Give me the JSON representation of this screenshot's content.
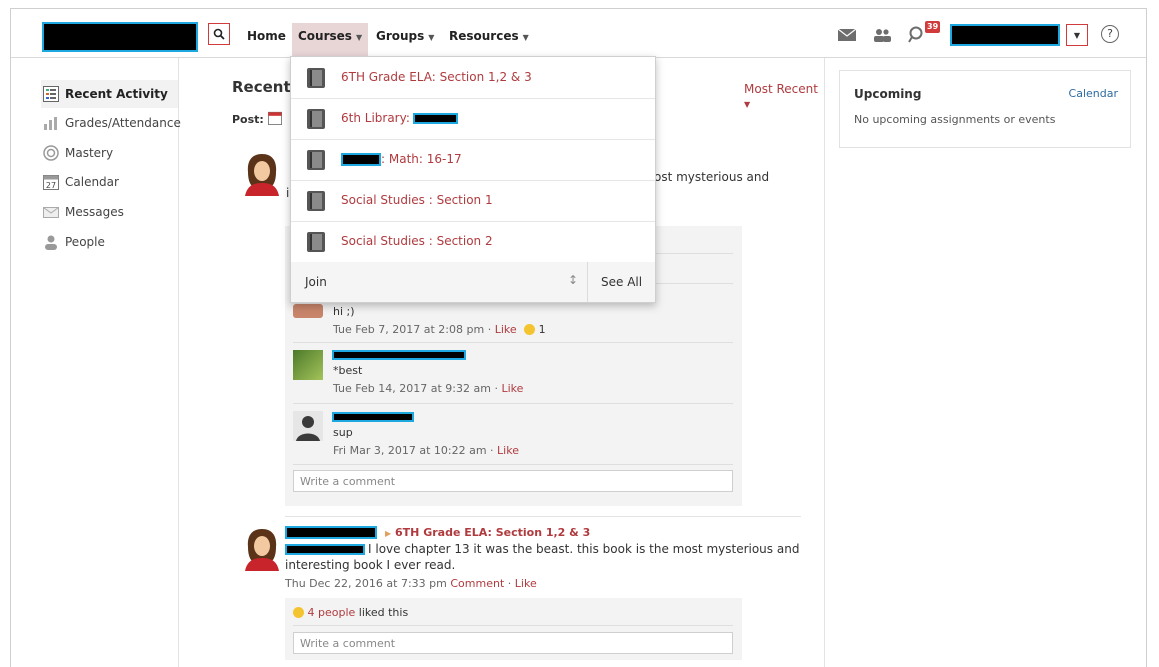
{
  "topbar": {
    "nav": {
      "home": "Home",
      "courses": "Courses",
      "groups": "Groups",
      "resources": "Resources"
    },
    "notifications_count": "39"
  },
  "sidebar": {
    "items": [
      {
        "label": "Recent Activity",
        "icon": "recent-activity-icon"
      },
      {
        "label": "Grades/Attendance",
        "icon": "grades-icon"
      },
      {
        "label": "Mastery",
        "icon": "mastery-icon"
      },
      {
        "label": "Calendar",
        "icon": "calendar-icon"
      },
      {
        "label": "Messages",
        "icon": "messages-icon"
      },
      {
        "label": "People",
        "icon": "people-icon"
      }
    ]
  },
  "main": {
    "title": "Recent",
    "post_label": "Post:",
    "sort_label": "Most Recent",
    "post1": {
      "text_tail": "ost mysterious and",
      "line2_start": "i",
      "comments": [
        {
          "text": "hi ;)",
          "time": "Tue Feb 7, 2017 at 2:08 pm",
          "like": "Like",
          "reactions": "1"
        },
        {
          "text": "*best",
          "time": "Tue Feb 14, 2017 at 9:32 am",
          "like": "Like"
        },
        {
          "text": "sup",
          "time": "Fri Mar 3, 2017 at 10:22 am",
          "like": "Like"
        }
      ],
      "comment_placeholder": "Write a comment"
    },
    "post2": {
      "course": "6TH Grade ELA: Section 1,2 & 3",
      "text_line1": "I love chapter 13 it was the beast. this book is the most mysterious and",
      "text_line2": "interesting book I ever read.",
      "time": "Thu Dec 22, 2016 at 7:33 pm",
      "comment_link": "Comment",
      "like_link": "Like",
      "liked_count": "4 people",
      "liked_suffix": "liked this",
      "comment_placeholder": "Write a comment"
    }
  },
  "courses_dropdown": {
    "items": [
      {
        "label": "6TH Grade ELA: Section 1,2 & 3"
      },
      {
        "label": "6th Library:"
      },
      {
        "label": ": Math: 16-17"
      },
      {
        "label": "Social Studies : Section 1"
      },
      {
        "label": "Social Studies : Section 2"
      }
    ],
    "join": "Join",
    "see_all": "See All"
  },
  "upcoming": {
    "title": "Upcoming",
    "calendar_link": "Calendar",
    "empty": "No upcoming assignments or events"
  },
  "colors": {
    "accent": "#b03b3f",
    "redaction_border": "#1ea8e0",
    "nav_active": "#e8d6d7"
  }
}
